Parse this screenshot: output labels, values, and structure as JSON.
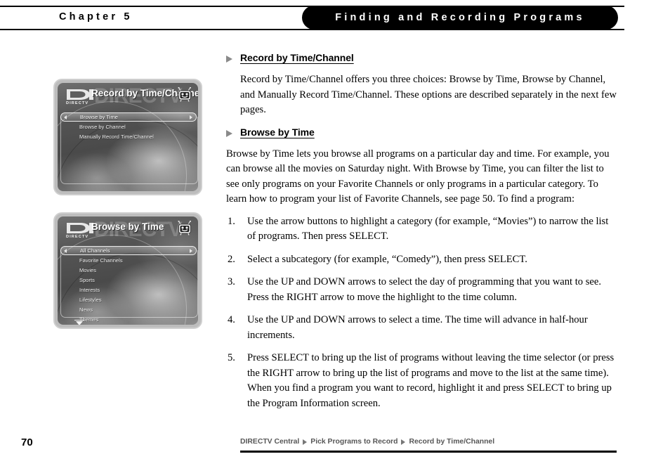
{
  "header": {
    "chapter": "Chapter 5",
    "section_title": "Finding and Recording Programs"
  },
  "screenshots": [
    {
      "name": "record-by-time-channel-screen",
      "title": "Record by Time/Channel",
      "logo_word": "DIRECTV",
      "watermark": "DIRECTV",
      "items": [
        {
          "label": "Browse by Time",
          "selected": true
        },
        {
          "label": "Browse by Channel",
          "selected": false
        },
        {
          "label": "Manually Record Time/Channel",
          "selected": false
        }
      ],
      "has_scroll_indicator": false
    },
    {
      "name": "browse-by-time-screen",
      "title": "Browse by Time",
      "logo_word": "DIRECTV",
      "watermark": "DIRECTV",
      "items": [
        {
          "label": "All Channels",
          "selected": true
        },
        {
          "label": "Favorite Channels",
          "selected": false
        },
        {
          "label": "Movies",
          "selected": false
        },
        {
          "label": "Sports",
          "selected": false
        },
        {
          "label": "Interests",
          "selected": false
        },
        {
          "label": "Lifestyles",
          "selected": false
        },
        {
          "label": "News",
          "selected": false
        },
        {
          "label": "Themes",
          "selected": false
        }
      ],
      "has_scroll_indicator": true
    }
  ],
  "content": {
    "section1": {
      "heading": "Record by Time/Channel",
      "paragraph": "Record by Time/Channel offers you three choices: Browse by Time, Browse by Channel, and Manually Record Time/Channel. These options are described separately in the next few pages."
    },
    "section2": {
      "heading": "Browse by Time",
      "paragraph": "Browse by Time lets you browse all programs on a particular day and time. For example, you can browse all the movies on Saturday night. With Browse by Time, you can filter the list to see only programs on your Favorite Channels or only programs in a particular category. To learn how to program your list of Favorite Channels, see page 50. To find a program:",
      "steps": [
        {
          "num": "1.",
          "text": "Use the arrow buttons to highlight a category (for example, “Movies”) to narrow the list of programs. Then press SELECT."
        },
        {
          "num": "2.",
          "text": "Select a subcategory (for example, “Comedy”), then press SELECT."
        },
        {
          "num": "3.",
          "text": "Use the UP and DOWN arrows to select the day of programming that you want to see. Press the RIGHT arrow to move the highlight to the time column."
        },
        {
          "num": "4.",
          "text": "Use the UP and DOWN arrows to select a time. The time will advance in half-hour increments."
        },
        {
          "num": "5.",
          "text": "Press SELECT to bring up the list of programs without leaving the time selector (or press the RIGHT arrow to bring up the list of programs and move to the list at the same time). When you find a program you want to record, highlight it and press SELECT to bring up the Program Information screen."
        }
      ]
    }
  },
  "footer": {
    "page_number": "70",
    "breadcrumb": [
      "DIRECTV Central",
      "Pick Programs to Record",
      "Record by Time/Channel"
    ]
  },
  "colors": {
    "header_pill_bg": "#000000",
    "header_pill_text": "#ffffff",
    "bullet_gray": "#8a8a8a",
    "breadcrumb_gray": "#575757",
    "rule_black": "#000000"
  }
}
